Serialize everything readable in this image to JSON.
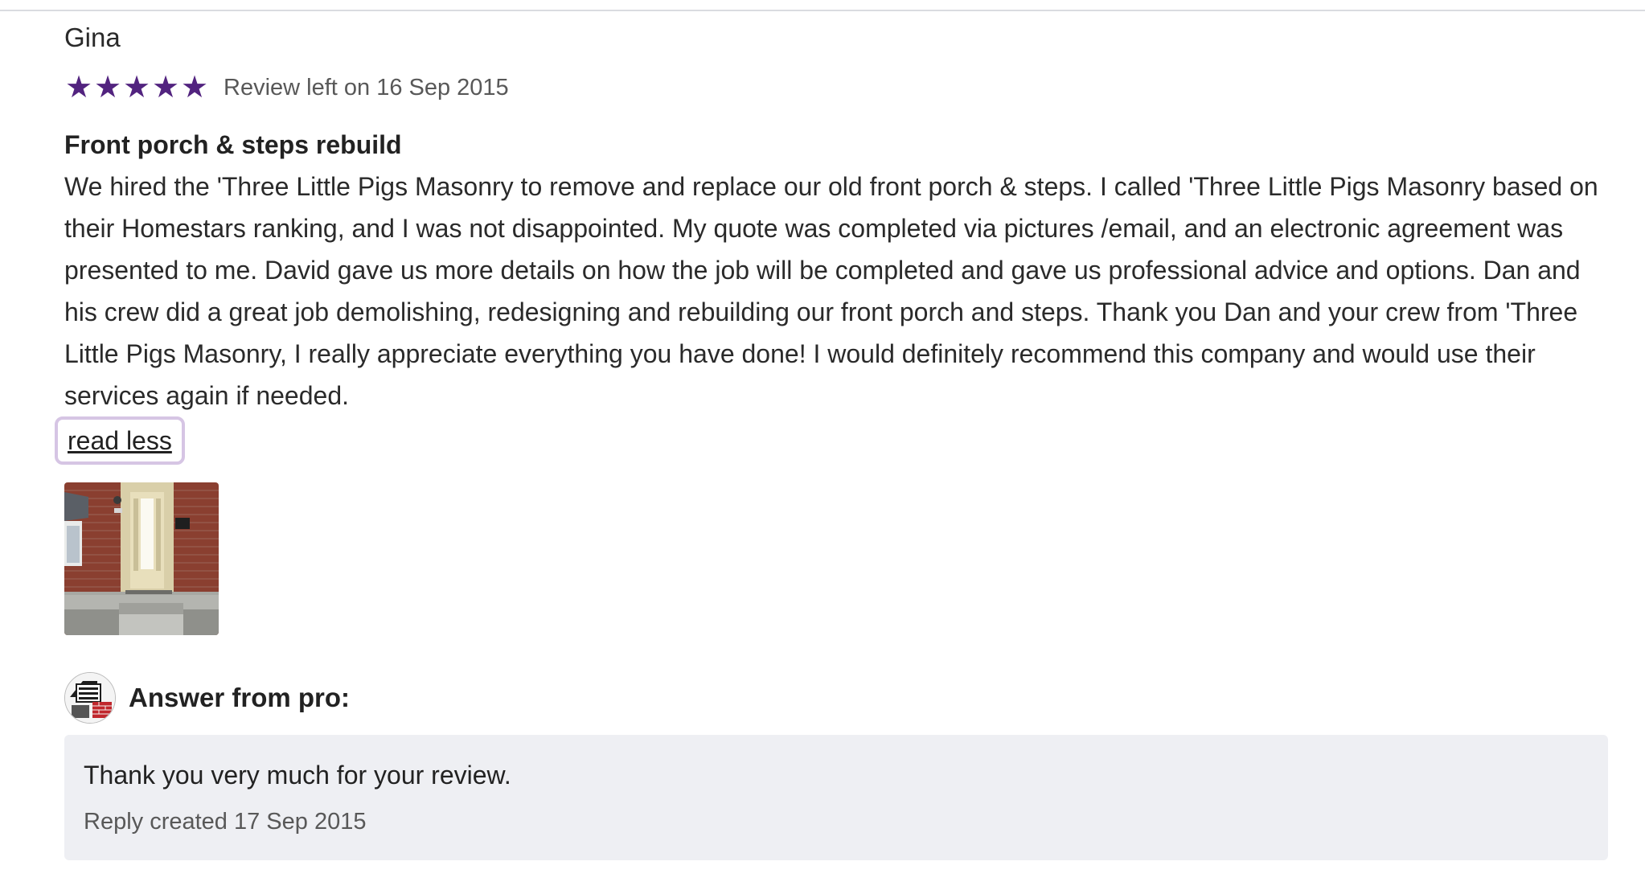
{
  "review": {
    "reviewer_name": "Gina",
    "rating": 5,
    "star_color": "#52237f",
    "stars": [
      "★",
      "★",
      "★",
      "★",
      "★"
    ],
    "date_text": "Review left on 16 Sep 2015",
    "title": "Front porch & steps rebuild",
    "body": "We hired the 'Three Little Pigs Masonry to remove and replace our old front porch & steps. I called 'Three Little Pigs Masonry based on their Homestars ranking, and I was not disappointed. My quote was completed via pictures /email, and an electronic agreement was presented to me. David gave us more details on how the job will be completed and gave us professional advice and options. Dan and his crew did a great job demolishing, redesigning and rebuilding our front porch and steps. Thank you Dan and your crew from 'Three Little Pigs Masonry, I really appreciate everything you have done! I would definitely recommend this company and would use their services again if needed.",
    "toggle_label": "read less",
    "photos": [
      "front-porch-photo"
    ]
  },
  "pro_answer": {
    "avatar_icon": "company-logo-avatar",
    "label": "Answer from pro:",
    "reply_text": "Thank you very much for your review.",
    "reply_date_text": "Reply created 17 Sep 2015"
  }
}
